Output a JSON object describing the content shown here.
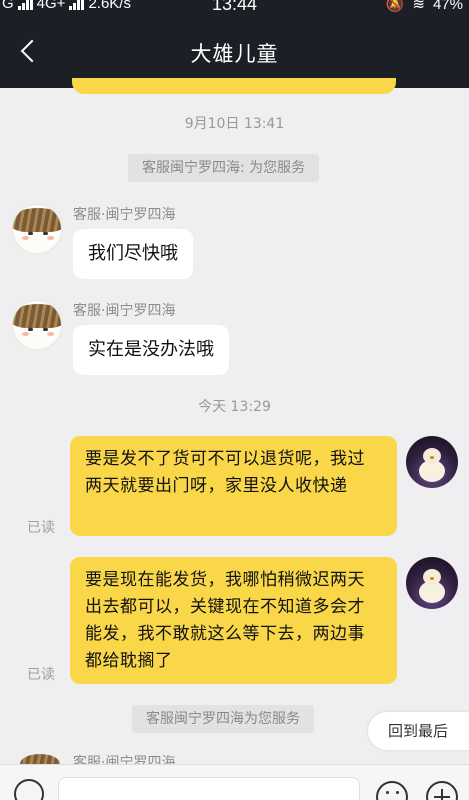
{
  "status_bar": {
    "network_label": "4G+",
    "carrier_glyph": "G",
    "speed": "2.6K/s",
    "time": "13:44",
    "battery": "47%"
  },
  "header": {
    "title": "大雄儿童",
    "back_icon": "chevron-left-icon"
  },
  "chat": {
    "timestamps": [
      "9月10日 13:41",
      "今天 13:29"
    ],
    "system_notices": [
      "客服闽宁罗四海: 为您服务",
      "客服闽宁罗四海为您服务"
    ],
    "incoming": [
      {
        "sender": "客服·闽宁罗四海",
        "text": "我们尽快哦"
      },
      {
        "sender": "客服·闽宁罗四海",
        "text": "实在是没办法哦"
      }
    ],
    "outgoing": [
      {
        "text": "要是发不了货可不可以退货呢，我过两天就要出门呀，家里没人收快递",
        "status": "已读"
      },
      {
        "text": "要是现在能发货，我哪怕稍微迟两天出去都可以，关键现在不知道多会才能发，我不敢就这么等下去，两边事都给耽搁了",
        "status": "已读"
      }
    ],
    "next_sender": "客服·闽宁罗四海"
  },
  "jump_button": {
    "label": "回到最后"
  },
  "input_bar": {
    "placeholder": "",
    "voice_icon": "voice-icon",
    "emoji_icon": "emoji-icon",
    "plus_icon": "plus-icon"
  },
  "colors": {
    "header_bg": "#1c1f26",
    "outgoing_bubble": "#f9d749",
    "incoming_bubble": "#ffffff",
    "chat_bg": "#efeff1"
  }
}
